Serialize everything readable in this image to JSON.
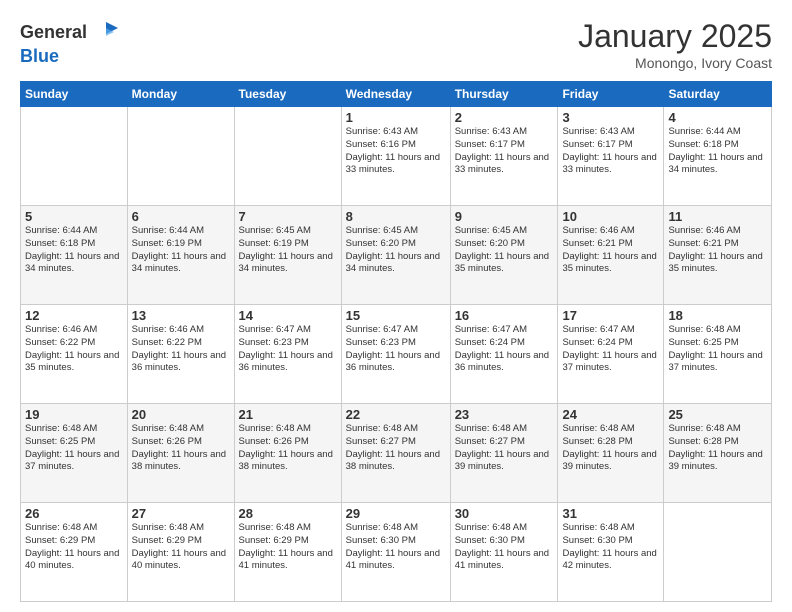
{
  "header": {
    "logo": {
      "general": "General",
      "blue": "Blue"
    },
    "title": "January 2025",
    "location": "Monongo, Ivory Coast"
  },
  "weekdays": [
    "Sunday",
    "Monday",
    "Tuesday",
    "Wednesday",
    "Thursday",
    "Friday",
    "Saturday"
  ],
  "weeks": [
    [
      {
        "day": "",
        "info": ""
      },
      {
        "day": "",
        "info": ""
      },
      {
        "day": "",
        "info": ""
      },
      {
        "day": "1",
        "info": "Sunrise: 6:43 AM\nSunset: 6:16 PM\nDaylight: 11 hours\nand 33 minutes."
      },
      {
        "day": "2",
        "info": "Sunrise: 6:43 AM\nSunset: 6:17 PM\nDaylight: 11 hours\nand 33 minutes."
      },
      {
        "day": "3",
        "info": "Sunrise: 6:43 AM\nSunset: 6:17 PM\nDaylight: 11 hours\nand 33 minutes."
      },
      {
        "day": "4",
        "info": "Sunrise: 6:44 AM\nSunset: 6:18 PM\nDaylight: 11 hours\nand 34 minutes."
      }
    ],
    [
      {
        "day": "5",
        "info": "Sunrise: 6:44 AM\nSunset: 6:18 PM\nDaylight: 11 hours\nand 34 minutes."
      },
      {
        "day": "6",
        "info": "Sunrise: 6:44 AM\nSunset: 6:19 PM\nDaylight: 11 hours\nand 34 minutes."
      },
      {
        "day": "7",
        "info": "Sunrise: 6:45 AM\nSunset: 6:19 PM\nDaylight: 11 hours\nand 34 minutes."
      },
      {
        "day": "8",
        "info": "Sunrise: 6:45 AM\nSunset: 6:20 PM\nDaylight: 11 hours\nand 34 minutes."
      },
      {
        "day": "9",
        "info": "Sunrise: 6:45 AM\nSunset: 6:20 PM\nDaylight: 11 hours\nand 35 minutes."
      },
      {
        "day": "10",
        "info": "Sunrise: 6:46 AM\nSunset: 6:21 PM\nDaylight: 11 hours\nand 35 minutes."
      },
      {
        "day": "11",
        "info": "Sunrise: 6:46 AM\nSunset: 6:21 PM\nDaylight: 11 hours\nand 35 minutes."
      }
    ],
    [
      {
        "day": "12",
        "info": "Sunrise: 6:46 AM\nSunset: 6:22 PM\nDaylight: 11 hours\nand 35 minutes."
      },
      {
        "day": "13",
        "info": "Sunrise: 6:46 AM\nSunset: 6:22 PM\nDaylight: 11 hours\nand 36 minutes."
      },
      {
        "day": "14",
        "info": "Sunrise: 6:47 AM\nSunset: 6:23 PM\nDaylight: 11 hours\nand 36 minutes."
      },
      {
        "day": "15",
        "info": "Sunrise: 6:47 AM\nSunset: 6:23 PM\nDaylight: 11 hours\nand 36 minutes."
      },
      {
        "day": "16",
        "info": "Sunrise: 6:47 AM\nSunset: 6:24 PM\nDaylight: 11 hours\nand 36 minutes."
      },
      {
        "day": "17",
        "info": "Sunrise: 6:47 AM\nSunset: 6:24 PM\nDaylight: 11 hours\nand 37 minutes."
      },
      {
        "day": "18",
        "info": "Sunrise: 6:48 AM\nSunset: 6:25 PM\nDaylight: 11 hours\nand 37 minutes."
      }
    ],
    [
      {
        "day": "19",
        "info": "Sunrise: 6:48 AM\nSunset: 6:25 PM\nDaylight: 11 hours\nand 37 minutes."
      },
      {
        "day": "20",
        "info": "Sunrise: 6:48 AM\nSunset: 6:26 PM\nDaylight: 11 hours\nand 38 minutes."
      },
      {
        "day": "21",
        "info": "Sunrise: 6:48 AM\nSunset: 6:26 PM\nDaylight: 11 hours\nand 38 minutes."
      },
      {
        "day": "22",
        "info": "Sunrise: 6:48 AM\nSunset: 6:27 PM\nDaylight: 11 hours\nand 38 minutes."
      },
      {
        "day": "23",
        "info": "Sunrise: 6:48 AM\nSunset: 6:27 PM\nDaylight: 11 hours\nand 39 minutes."
      },
      {
        "day": "24",
        "info": "Sunrise: 6:48 AM\nSunset: 6:28 PM\nDaylight: 11 hours\nand 39 minutes."
      },
      {
        "day": "25",
        "info": "Sunrise: 6:48 AM\nSunset: 6:28 PM\nDaylight: 11 hours\nand 39 minutes."
      }
    ],
    [
      {
        "day": "26",
        "info": "Sunrise: 6:48 AM\nSunset: 6:29 PM\nDaylight: 11 hours\nand 40 minutes."
      },
      {
        "day": "27",
        "info": "Sunrise: 6:48 AM\nSunset: 6:29 PM\nDaylight: 11 hours\nand 40 minutes."
      },
      {
        "day": "28",
        "info": "Sunrise: 6:48 AM\nSunset: 6:29 PM\nDaylight: 11 hours\nand 41 minutes."
      },
      {
        "day": "29",
        "info": "Sunrise: 6:48 AM\nSunset: 6:30 PM\nDaylight: 11 hours\nand 41 minutes."
      },
      {
        "day": "30",
        "info": "Sunrise: 6:48 AM\nSunset: 6:30 PM\nDaylight: 11 hours\nand 41 minutes."
      },
      {
        "day": "31",
        "info": "Sunrise: 6:48 AM\nSunset: 6:30 PM\nDaylight: 11 hours\nand 42 minutes."
      },
      {
        "day": "",
        "info": ""
      }
    ]
  ]
}
